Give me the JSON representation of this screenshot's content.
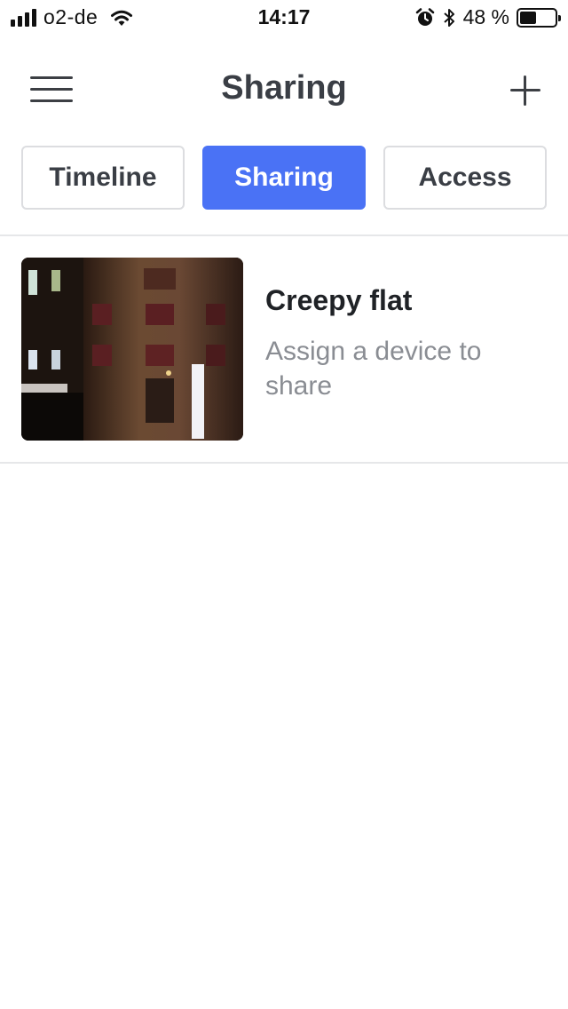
{
  "status_bar": {
    "carrier": "o2-de",
    "time": "14:17",
    "battery_text": "48 %",
    "battery_level": 0.48,
    "icons": [
      "signal-icon",
      "wifi-icon",
      "alarm-icon",
      "bluetooth-icon",
      "battery-icon"
    ]
  },
  "header": {
    "title": "Sharing",
    "menu_icon": "hamburger-menu-icon",
    "add_icon": "plus-icon"
  },
  "tabs": [
    {
      "label": "Timeline",
      "active": false
    },
    {
      "label": "Sharing",
      "active": true
    },
    {
      "label": "Access",
      "active": false
    }
  ],
  "items": [
    {
      "title": "Creepy flat",
      "subtitle": "Assign a device to share",
      "image": "building-at-night-photo"
    }
  ],
  "colors": {
    "accent": "#4a72f5",
    "text_primary": "#1f2226",
    "text_secondary": "#8a8d93",
    "divider": "#e6e7e9"
  }
}
